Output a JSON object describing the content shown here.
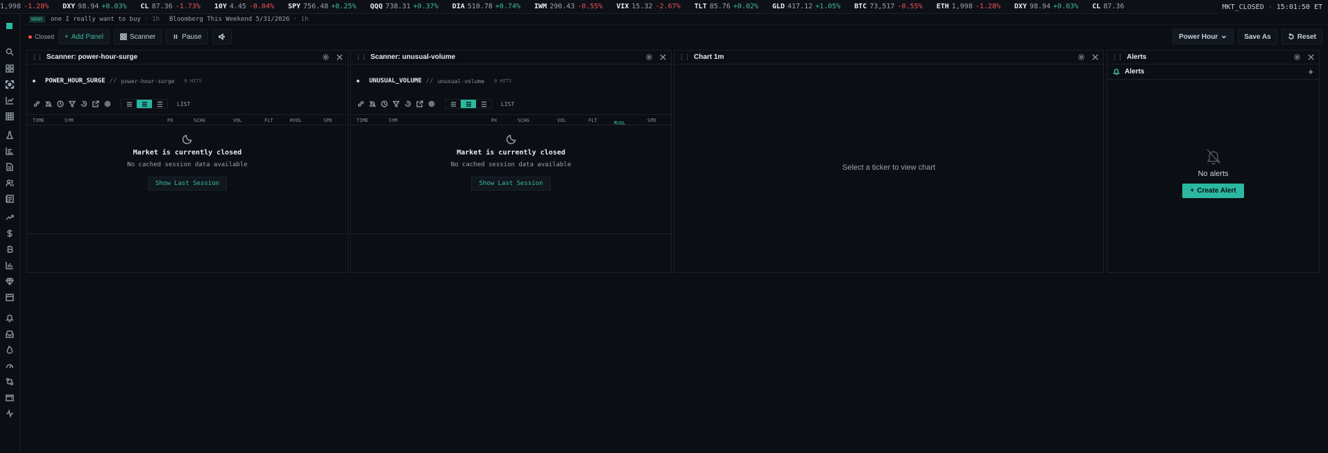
{
  "ticker": [
    {
      "sym": "",
      "px": "1,998",
      "chg": "-1.28%",
      "dir": "dn"
    },
    {
      "sym": "DXY",
      "px": "98.94",
      "chg": "+0.03%",
      "dir": "up"
    },
    {
      "sym": "CL",
      "px": "87.36",
      "chg": "-1.73%",
      "dir": "dn"
    },
    {
      "sym": "10Y",
      "px": "4.45",
      "chg": "-0.04%",
      "dir": "dn"
    },
    {
      "sym": "SPY",
      "px": "756.48",
      "chg": "+0.25%",
      "dir": "up"
    },
    {
      "sym": "QQQ",
      "px": "738.31",
      "chg": "+0.37%",
      "dir": "up"
    },
    {
      "sym": "DIA",
      "px": "510.78",
      "chg": "+0.74%",
      "dir": "up"
    },
    {
      "sym": "IWM",
      "px": "290.43",
      "chg": "-0.55%",
      "dir": "dn"
    },
    {
      "sym": "VIX",
      "px": "15.32",
      "chg": "-2.67%",
      "dir": "dn"
    },
    {
      "sym": "TLT",
      "px": "85.76",
      "chg": "+0.02%",
      "dir": "up"
    },
    {
      "sym": "GLD",
      "px": "417.12",
      "chg": "+1.05%",
      "dir": "up"
    },
    {
      "sym": "BTC",
      "px": "73,517",
      "chg": "-0.55%",
      "dir": "dn"
    },
    {
      "sym": "ETH",
      "px": "1,998",
      "chg": "-1.28%",
      "dir": "dn"
    },
    {
      "sym": "DXY",
      "px": "98.94",
      "chg": "+0.03%",
      "dir": "up"
    },
    {
      "sym": "CL",
      "px": "87.36",
      "chg": "",
      "dir": "dn"
    }
  ],
  "market": {
    "status": "MKT_CLOSED",
    "sep": "·",
    "time": "15:01:50 ET"
  },
  "news": {
    "tag": "NEWS",
    "items": [
      {
        "text": "one I really want to buy",
        "age": "· 1h"
      },
      {
        "text": "Bloomberg This Weekend 5/31/2026",
        "age": "· 1h"
      }
    ]
  },
  "toolbar": {
    "closed_label": "Closed",
    "add_panel": "Add Panel",
    "scanner": "Scanner",
    "pause": "Pause",
    "preset": "Power Hour",
    "save_as": "Save As",
    "reset": "Reset"
  },
  "scanner1": {
    "title": "Scanner: power-hour-surge",
    "name": "POWER_HOUR_SURGE",
    "slash": "//",
    "slug": "power-hour-surge",
    "hits": "0 HITS",
    "list_label": "LIST",
    "columns": [
      "TIME",
      "SYM",
      "PX",
      "%CHG",
      "VOL",
      "FLT",
      "RVOL",
      "SPD"
    ],
    "closed_title": "Market is currently closed",
    "closed_sub": "No cached session data available",
    "show_last": "Show Last Session"
  },
  "scanner2": {
    "title": "Scanner: unusual-volume",
    "name": "UNUSUAL_VOLUME",
    "slash": "//",
    "slug": "unusual-volume",
    "hits": "0 HITS",
    "list_label": "LIST",
    "columns": [
      "TIME",
      "SYM",
      "PX",
      "%CHG",
      "VOL",
      "FLT",
      "RVOL",
      "SPD"
    ],
    "sorted_column": "RVOL",
    "closed_title": "Market is currently closed",
    "closed_sub": "No cached session data available",
    "show_last": "Show Last Session"
  },
  "chart": {
    "title": "Chart 1m",
    "empty": "Select a ticker to view chart"
  },
  "alerts": {
    "title": "Alerts",
    "sub_title": "Alerts",
    "add": "+",
    "empty": "No alerts",
    "create": "Create Alert"
  },
  "colors": {
    "accent": "#2bb8a0",
    "up": "#3fb9a3",
    "down": "#f05252",
    "bg": "#0b0e13"
  }
}
